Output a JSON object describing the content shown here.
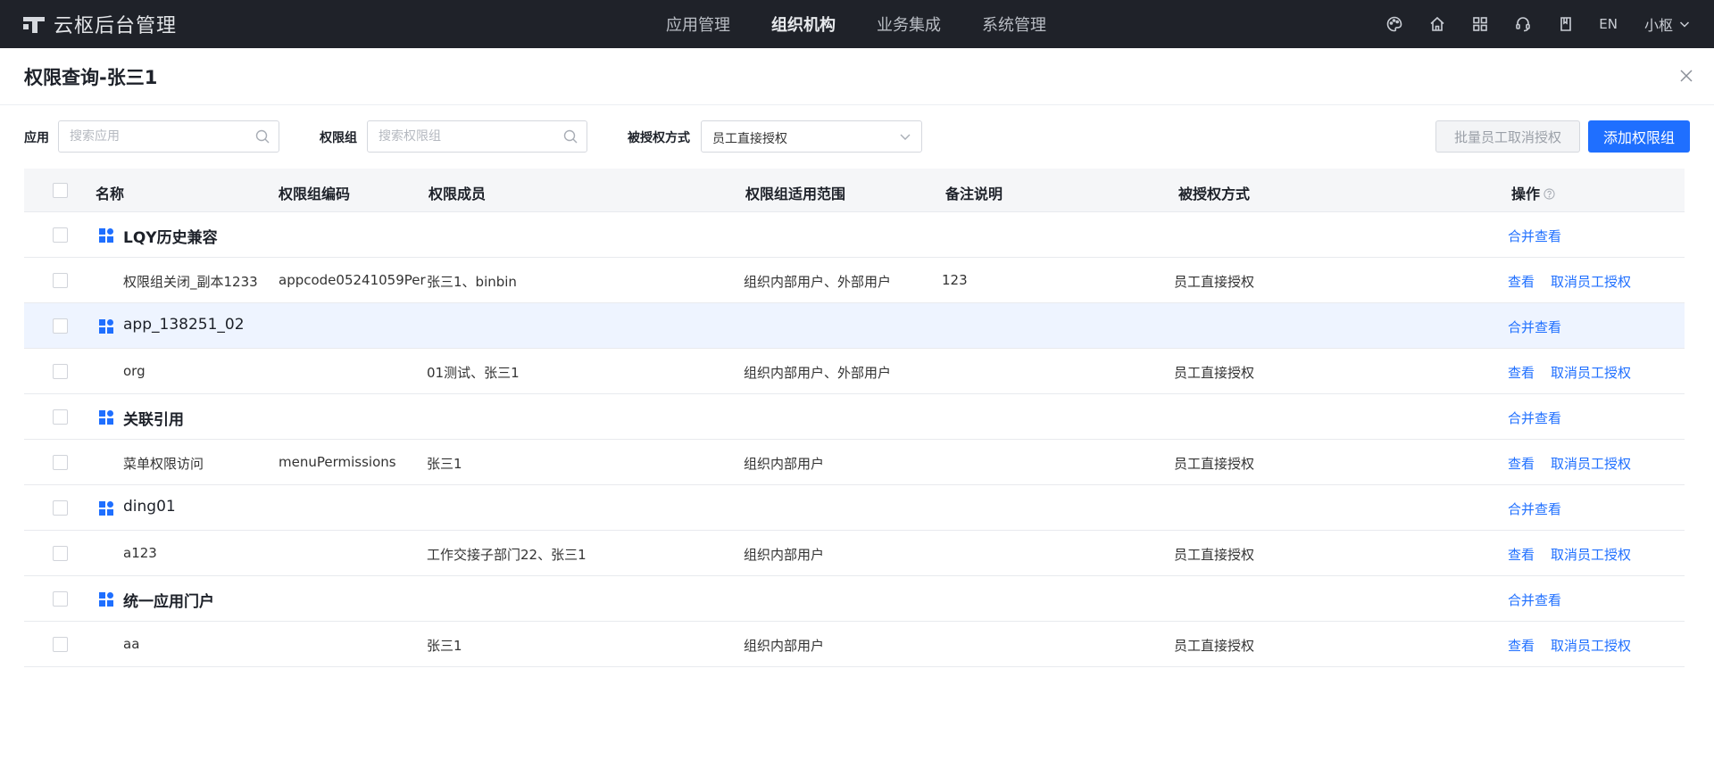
{
  "app": {
    "title": "云枢后台管理"
  },
  "nav": [
    {
      "label": "应用管理",
      "active": false
    },
    {
      "label": "组织机构",
      "active": true
    },
    {
      "label": "业务集成",
      "active": false
    },
    {
      "label": "系统管理",
      "active": false
    }
  ],
  "header_tools": {
    "lang": "EN",
    "user": "小枢"
  },
  "panel": {
    "title": "权限查询-张三1"
  },
  "filters": {
    "app_label": "应用",
    "app_placeholder": "搜索应用",
    "group_label": "权限组",
    "group_placeholder": "搜索权限组",
    "grant_label": "被授权方式",
    "grant_value": "员工直接授权",
    "batch_cancel_label": "批量员工取消授权",
    "add_group_label": "添加权限组"
  },
  "table": {
    "columns": [
      "名称",
      "权限组编码",
      "权限成员",
      "权限组适用范围",
      "备注说明",
      "被授权方式",
      "操作"
    ],
    "group_action": "合并查看",
    "view_action": "查看",
    "cancel_action": "取消员工授权",
    "groups": [
      {
        "name": "LQY历史兼容",
        "row": {
          "name": "权限组关闭_副本1233",
          "code": "appcode05241059Per",
          "members": "张三1、binbin",
          "scope": "组织内部用户、外部用户",
          "remark": "123",
          "grant": "员工直接授权"
        }
      },
      {
        "name": "app_138251_02",
        "row": {
          "name": "org",
          "code": "",
          "members": "01测试、张三1",
          "scope": "组织内部用户、外部用户",
          "remark": "",
          "grant": "员工直接授权"
        }
      },
      {
        "name": "关联引用",
        "row": {
          "name": "菜单权限访问",
          "code": "menuPermissions",
          "members": "张三1",
          "scope": "组织内部用户",
          "remark": "",
          "grant": "员工直接授权"
        }
      },
      {
        "name": "ding01",
        "row": {
          "name": "a123",
          "code": "",
          "members": "工作交接子部门22、张三1",
          "scope": "组织内部用户",
          "remark": "",
          "grant": "员工直接授权"
        }
      },
      {
        "name": "统一应用门户",
        "row": {
          "name": "aa",
          "code": "",
          "members": "张三1",
          "scope": "组织内部用户",
          "remark": "",
          "grant": "员工直接授权"
        }
      }
    ]
  },
  "colors": {
    "primary": "#1f6fff",
    "topbar": "#1f2229",
    "row_highlight": "#eef4ff"
  }
}
